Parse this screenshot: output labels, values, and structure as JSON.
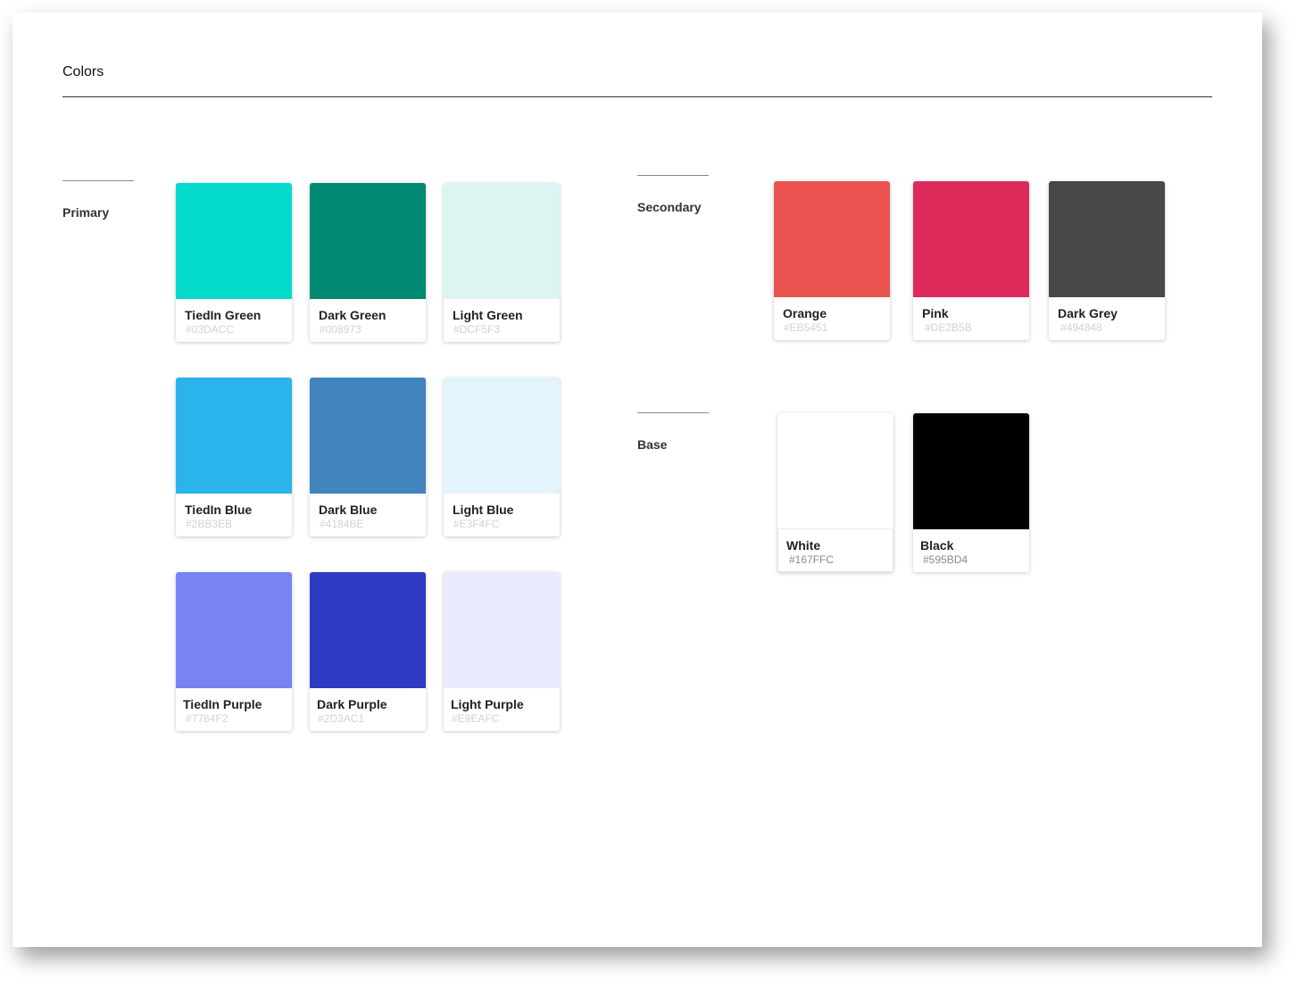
{
  "page": {
    "title": "Colors"
  },
  "sections": {
    "primary": {
      "label": "Primary",
      "swatches": [
        {
          "name": "TiedIn Green",
          "hex": "#03DACC",
          "color": "#03DACC"
        },
        {
          "name": "Dark Green",
          "hex": "#008973",
          "color": "#008973"
        },
        {
          "name": "Light Green",
          "hex": "#DCF5F3",
          "color": "#DCF5F3"
        },
        {
          "name": "TiedIn Blue",
          "hex": "#2BB3EB",
          "color": "#2BB3EB"
        },
        {
          "name": "Dark Blue",
          "hex": "#4184BE",
          "color": "#4184BE"
        },
        {
          "name": "Light Blue",
          "hex": "#E3F4FC",
          "color": "#E3F4FC"
        },
        {
          "name": "TiedIn Purple",
          "hex": "#7784F2",
          "color": "#7784F2"
        },
        {
          "name": "Dark Purple",
          "hex": "#2D3AC1",
          "color": "#2D3AC1"
        },
        {
          "name": "Light Purple",
          "hex": "#E9EAFC",
          "color": "#E9EAFC"
        }
      ]
    },
    "secondary": {
      "label": "Secondary",
      "swatches": [
        {
          "name": "Orange",
          "hex": "#EB5451",
          "color": "#EB5451"
        },
        {
          "name": "Pink",
          "hex": "#DE2B5B",
          "color": "#DE2B5B"
        },
        {
          "name": "Dark Grey",
          "hex": "#494848",
          "color": "#494848"
        }
      ]
    },
    "base": {
      "label": "Base",
      "swatches": [
        {
          "name": "White",
          "hex": "#167FFC",
          "color": "#FFFFFF"
        },
        {
          "name": "Black",
          "hex": "#595BD4",
          "color": "#000000"
        }
      ]
    }
  }
}
